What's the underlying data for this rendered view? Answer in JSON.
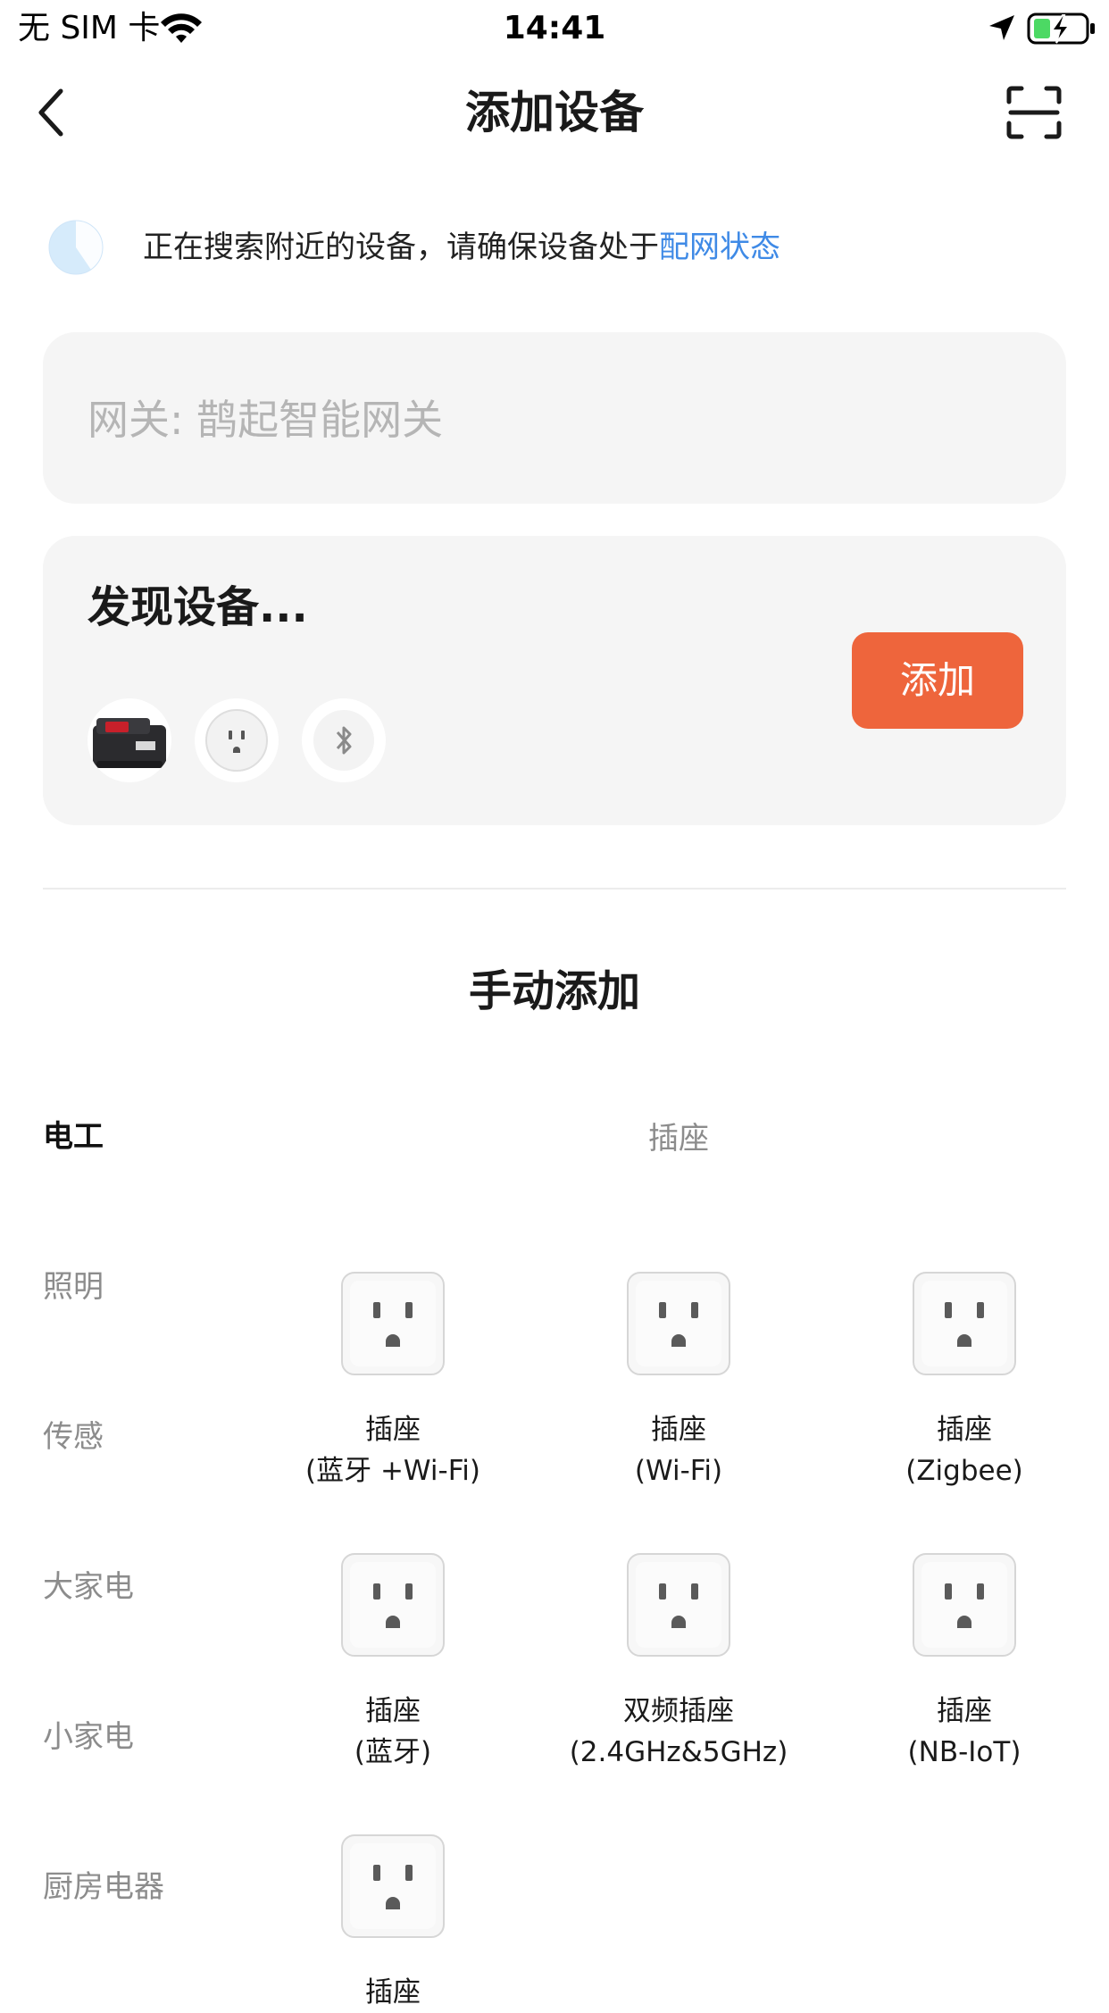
{
  "status_bar": {
    "carrier": "无 SIM 卡",
    "time": "14:41"
  },
  "nav": {
    "title": "添加设备"
  },
  "search": {
    "text": "正在搜索附近的设备，请确保设备处于",
    "link": "配网状态"
  },
  "gateway": {
    "text": "网关: 鹊起智能网关"
  },
  "discover": {
    "title": "发现设备...",
    "add_label": "添加",
    "devices": [
      "battery-pack",
      "smart-plug",
      "bluetooth-device"
    ]
  },
  "manual": {
    "title": "手动添加"
  },
  "categories": [
    {
      "label": "电工",
      "active": true
    },
    {
      "label": "照明",
      "active": false
    },
    {
      "label": "传感",
      "active": false
    },
    {
      "label": "大家电",
      "active": false
    },
    {
      "label": "小家电",
      "active": false
    },
    {
      "label": "厨房电器",
      "active": false
    }
  ],
  "section": {
    "title": "插座"
  },
  "products": [
    {
      "name": "插座",
      "sub": "(蓝牙 +Wi-Fi)"
    },
    {
      "name": "插座",
      "sub": "(Wi-Fi)"
    },
    {
      "name": "插座",
      "sub": "(Zigbee)"
    },
    {
      "name": "插座",
      "sub": "(蓝牙)"
    },
    {
      "name": "双频插座",
      "sub": "(2.4GHz&5GHz)"
    },
    {
      "name": "插座",
      "sub": "(NB-IoT)"
    },
    {
      "name": "插座",
      "sub": ""
    }
  ],
  "colors": {
    "accent": "#ee653c",
    "link": "#3f8ae6",
    "card_bg": "#f5f5f5",
    "muted_text": "#8c8c8c"
  }
}
